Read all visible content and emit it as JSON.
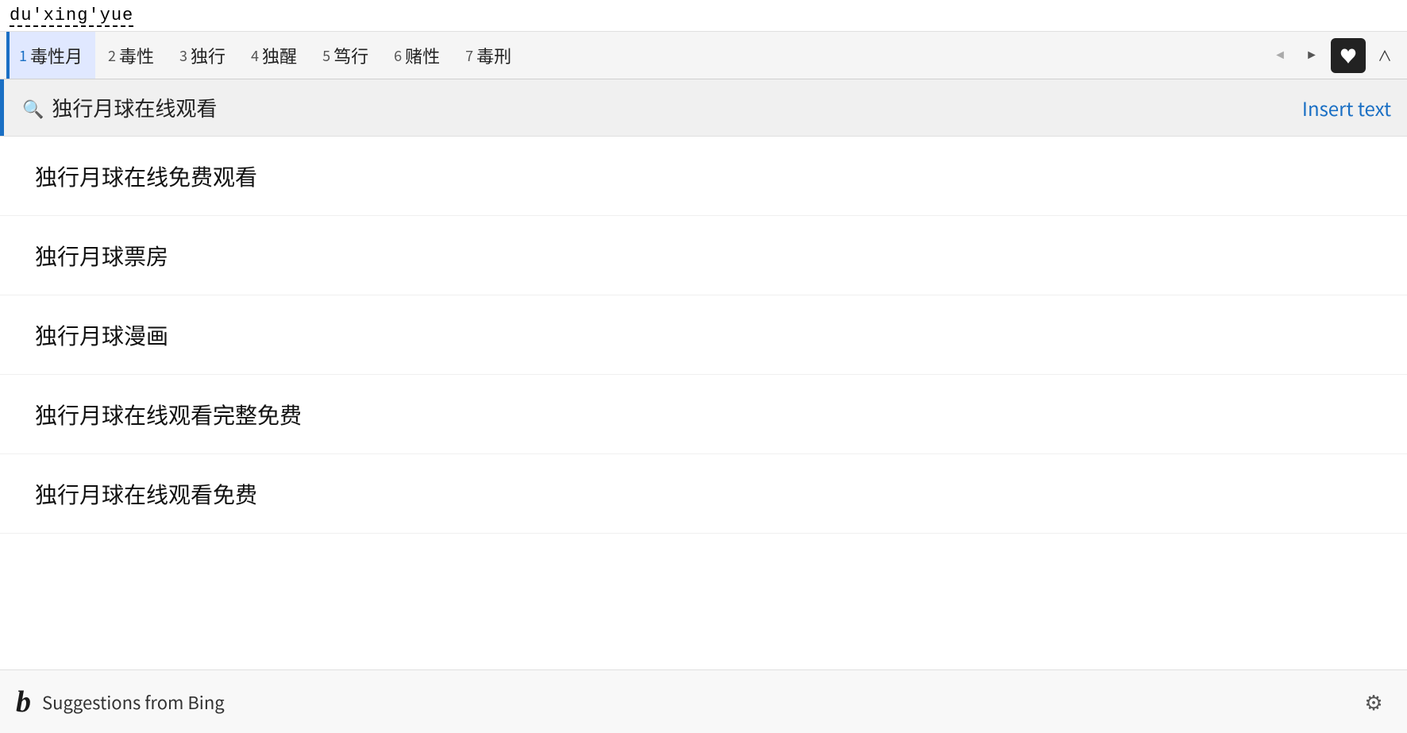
{
  "ime": {
    "input_text": "du'xing'yue"
  },
  "candidates_bar": {
    "items": [
      {
        "num": "1",
        "label": "毒性月",
        "selected": true
      },
      {
        "num": "2",
        "label": "毒性",
        "selected": false
      },
      {
        "num": "3",
        "label": "独行",
        "selected": false
      },
      {
        "num": "4",
        "label": "独醒",
        "selected": false
      },
      {
        "num": "5",
        "label": "笃行",
        "selected": false
      },
      {
        "num": "6",
        "label": "赌性",
        "selected": false
      },
      {
        "num": "7",
        "label": "毒刑",
        "selected": false
      }
    ],
    "prev_label": "◄",
    "next_label": "►",
    "collapse_label": "∧"
  },
  "search_bar": {
    "search_icon": "🔍",
    "query": "独行月球在线观看",
    "insert_text_label": "Insert text"
  },
  "suggestions": {
    "items": [
      {
        "text": "独行月球在线免费观看"
      },
      {
        "text": "独行月球票房"
      },
      {
        "text": "独行月球漫画"
      },
      {
        "text": "独行月球在线观看完整免费"
      },
      {
        "text": "独行月球在线观看免费"
      }
    ]
  },
  "footer": {
    "bing_logo": "b",
    "suggestions_label": "Suggestions from Bing",
    "settings_icon": "⚙"
  },
  "colors": {
    "accent_blue": "#1a6fc4",
    "selected_bg": "#e0e8ff",
    "bar_bg": "#f5f5f5"
  }
}
